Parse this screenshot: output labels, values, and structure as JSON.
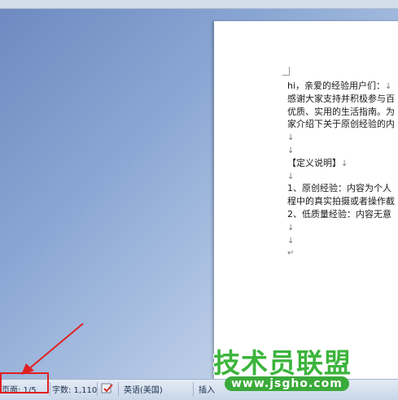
{
  "document": {
    "lines": [
      {
        "text": "hi，亲爱的经验用户们：",
        "mark": "↓"
      },
      {
        "text": "感谢大家支持并积极参与百",
        "mark": ""
      },
      {
        "text": "优质、实用的生活指南。为",
        "mark": ""
      },
      {
        "text": "家介绍下关于原创经验的内",
        "mark": ""
      },
      {
        "text": "",
        "mark": "↓"
      },
      {
        "text": "",
        "mark": "↓"
      },
      {
        "text": "【定义说明】",
        "mark": "↓"
      },
      {
        "text": "",
        "mark": "↓"
      },
      {
        "text": "1、原创经验：内容为个人",
        "mark": ""
      },
      {
        "text": "程中的真实拍摄或者操作截",
        "mark": ""
      },
      {
        "text": "2、低质量经验：内容无意",
        "mark": ""
      },
      {
        "text": "",
        "mark": "↓"
      },
      {
        "text": "",
        "mark": "↓"
      },
      {
        "text": "",
        "mark": "↵"
      }
    ]
  },
  "statusbar": {
    "page_label": "页面: 1/5",
    "word_count": "字数: 1,110",
    "language": "英语(美国)",
    "insert_mode": "插入"
  },
  "watermark": {
    "title": "技术员联盟",
    "url": "www.jsgho.com"
  },
  "colors": {
    "highlight": "#e02020",
    "watermark_green": "#3cb43c"
  }
}
